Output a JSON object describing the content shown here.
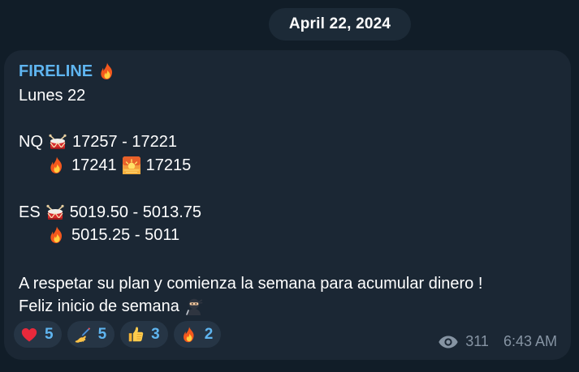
{
  "date_pill": "April 22, 2024",
  "message": {
    "sender": "FIRELINE",
    "lines": {
      "day": "Lunes 22",
      "nq_symbol": "NQ",
      "nq_range": "17257 - 17221",
      "nq_fire_value": "17241",
      "nq_sunset_value": "17215",
      "es_symbol": "ES",
      "es_range": "5019.50 - 5013.75",
      "es_fire_range": "5015.25 - 5011",
      "closing_1": "A respetar su plan y comienza la semana para acumular dinero !",
      "closing_2": "Feliz inicio de semana"
    },
    "emoji_icons": {
      "sender": "fire-icon",
      "nq_drum": "drum-icon",
      "nq_fire": "fire-icon",
      "nq_sunset": "sunset-icon",
      "es_drum": "drum-icon",
      "es_fire": "fire-icon",
      "closing": "ninja-icon"
    },
    "reactions": [
      {
        "icon": "heart-icon",
        "count": "5"
      },
      {
        "icon": "writing-hand-icon",
        "count": "5"
      },
      {
        "icon": "thumbs-up-icon",
        "count": "3"
      },
      {
        "icon": "fire-icon",
        "count": "2"
      }
    ],
    "views": "311",
    "time": "6:43 AM"
  },
  "colors": {
    "background": "#111d28",
    "bubble": "#1b2734",
    "sender": "#5fb5f0",
    "reaction_count": "#5fb5f0",
    "meta": "#8694a3"
  }
}
